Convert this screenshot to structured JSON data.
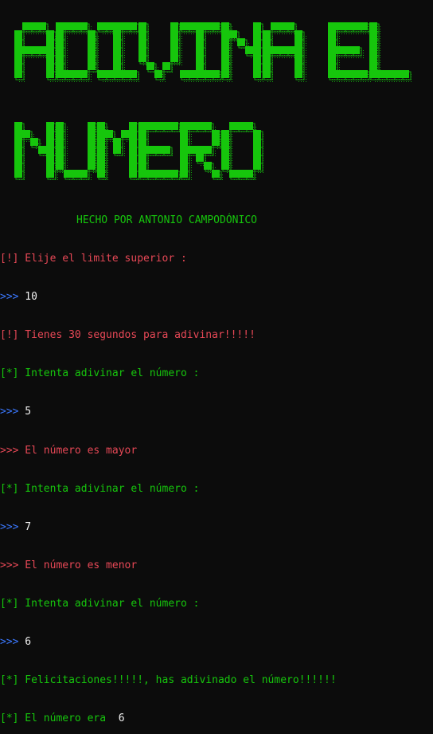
{
  "banner": {
    "lines": [
      "ADIVINA EL",
      "NUMERO"
    ],
    "color": "#16c60c",
    "shadow_color": "#13a10e"
  },
  "credit": "HECHO POR ANTONIO CAMPODÓNICO",
  "colors": {
    "background": "#0c0c0c",
    "red": "#e74856",
    "green": "#16c60c",
    "blue": "#3b78ff",
    "white": "#f2f2f2"
  },
  "console": [
    {
      "prefix": "[!]",
      "text": " Elije el limite superior :",
      "prefix_color": "red",
      "text_color": "red"
    },
    {
      "prefix": ">>>",
      "text": " 10",
      "prefix_color": "blue",
      "text_color": "white"
    },
    {
      "prefix": "[!]",
      "text": " Tienes 30 segundos para adivinar!!!!!",
      "prefix_color": "red",
      "text_color": "red"
    },
    {
      "prefix": "[*]",
      "text": " Intenta adivinar el número :",
      "prefix_color": "green",
      "text_color": "green"
    },
    {
      "prefix": ">>>",
      "text": " 5",
      "prefix_color": "blue",
      "text_color": "white"
    },
    {
      "prefix": ">>>",
      "text": " El número es mayor",
      "prefix_color": "red",
      "text_color": "red"
    },
    {
      "prefix": "[*]",
      "text": " Intenta adivinar el número :",
      "prefix_color": "green",
      "text_color": "green"
    },
    {
      "prefix": ">>>",
      "text": " 7",
      "prefix_color": "blue",
      "text_color": "white"
    },
    {
      "prefix": ">>>",
      "text": " El número es menor",
      "prefix_color": "red",
      "text_color": "red"
    },
    {
      "prefix": "[*]",
      "text": " Intenta adivinar el número :",
      "prefix_color": "green",
      "text_color": "green"
    },
    {
      "prefix": ">>>",
      "text": " 6",
      "prefix_color": "blue",
      "text_color": "white"
    },
    {
      "prefix": "[*]",
      "text": " Felicitaciones!!!!!, has adivinado el número!!!!!!",
      "prefix_color": "green",
      "text_color": "green"
    },
    {
      "prefix": "[*]",
      "text": " El número era",
      "prefix_color": "green",
      "text_color": "green",
      "value": "  6",
      "value_color": "white"
    }
  ]
}
